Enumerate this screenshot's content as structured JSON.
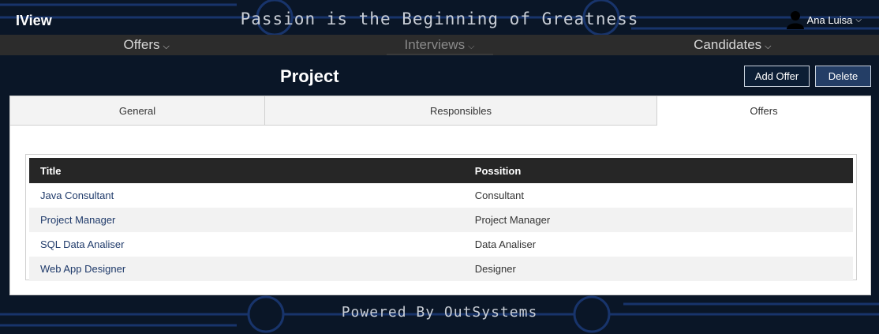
{
  "header": {
    "logo": "IView",
    "motto": "Passion is the Beginning of Greatness",
    "user_name": "Ana Luisa"
  },
  "nav": {
    "items": [
      {
        "label": "Offers"
      },
      {
        "label": "Interviews"
      },
      {
        "label": "Candidates"
      }
    ],
    "active": "Interviews"
  },
  "page": {
    "title": "Project",
    "add_offer_label": "Add Offer",
    "delete_label": "Delete"
  },
  "tabs": [
    {
      "label": "General"
    },
    {
      "label": "Responsibles"
    },
    {
      "label": "Offers"
    }
  ],
  "active_tab": "Offers",
  "table": {
    "headers": [
      "Title",
      "Possition"
    ],
    "rows": [
      {
        "title": "Java Consultant",
        "position": "Consultant"
      },
      {
        "title": "Project Manager",
        "position": "Project Manager"
      },
      {
        "title": "SQL Data Analiser",
        "position": "Data Analiser"
      },
      {
        "title": "Web App Designer",
        "position": "Designer"
      }
    ]
  },
  "footer": {
    "text": "Powered By OutSystems"
  },
  "colors": {
    "background": "#0a1627",
    "nav_bar": "#2c2c2c",
    "table_header": "#262626",
    "link": "#1f3a6a",
    "circuit": "#1b3a78"
  },
  "icons": {
    "user": "user-silhouette-icon",
    "dropdown": "chevron-down-icon"
  }
}
